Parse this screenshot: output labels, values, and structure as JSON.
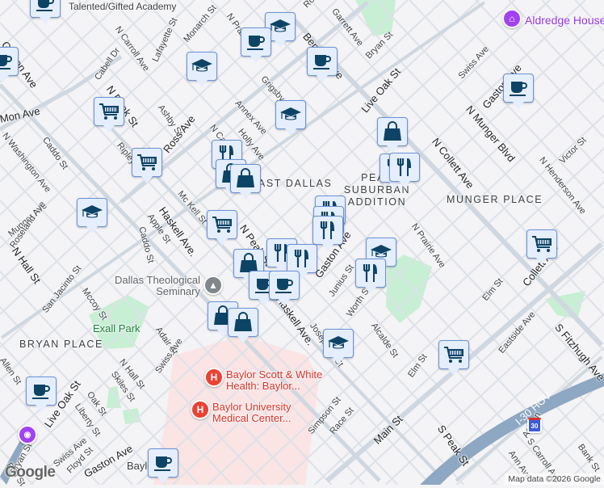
{
  "map": {
    "attribution": "Map data ©2026 Google",
    "logo": "Google",
    "colors": {
      "background": "#f4f3f5",
      "road": "#d9dfe6",
      "park": "#c6efd3",
      "hospital": "#fbe4e4",
      "highway": "#8ea7c2",
      "marker_bg": "#e5eefc",
      "marker_border": "#6a93d8",
      "marker_icon": "#0d4466"
    },
    "streets": [
      "Talented/Gifted Academy",
      "N Carroll Ave",
      "Lafayette St",
      "Monarch St",
      "N Prairie Ave",
      "Ross Ave",
      "Garrett Ave",
      "Bryan St",
      "Bennett Ave",
      "Cabell Dr",
      "N Peak St",
      "Grigsby Ave",
      "Live Oak St",
      "Swiss Ave",
      "Gaston Ave",
      "Ashby St",
      "Annex Ave",
      "Holly Ave",
      "N Carroll Ave",
      "Ripley St",
      "Mc Kell St",
      "Haskell Ave.",
      "N Peak St",
      "N Collett Ave",
      "N Munger Blvd",
      "N Henderson Ave",
      "Victor St",
      "Caddo St",
      "N Washington Ave",
      "Munger Ave",
      "Roseland Ave",
      "N Hall St",
      "Apple St",
      "Caddo St",
      "San Jacinto St",
      "Mccoy St",
      "Adair St",
      "Swiss Ave",
      "N Hall St",
      "Skiles St",
      "Allen St",
      "Live Oak St",
      "Oak St",
      "Liberty St",
      "Swiss Ave",
      "Floyd St",
      "Gaston Ave",
      "Junius St",
      "Worth St",
      "Alcalde St",
      "Elm St",
      "Elm St",
      "Eastside Ave",
      "Collett Ave",
      "S Fitzhugh Ave",
      "Main St",
      "S Peak St",
      "Simpson St",
      "Race St",
      "I-30 HOV",
      "Ash Ln",
      "S Carroll Ave",
      "Bank St",
      "Ann Ave",
      "Josephine St",
      "N Prairie Ave",
      "Gaston Ave",
      "Elm St",
      "Haskell Ave.",
      "Bryan St",
      "Mon Ave",
      "Gaston Ave"
    ],
    "neighborhoods": [
      "EAST DALLAS",
      "PEAK SUBURBAN ADDITION",
      "MUNGER PLACE",
      "BRYAN PLACE"
    ],
    "pois": {
      "aldredge": "Aldredge House",
      "seminary": "Dallas Theological Seminary",
      "park": "Exall Park",
      "hospital1": "Baylor Scott & White Health: Baylor...",
      "hospital2": "Baylor University Medical Center...",
      "station": "Baylor"
    },
    "interstate_shield": "30"
  }
}
